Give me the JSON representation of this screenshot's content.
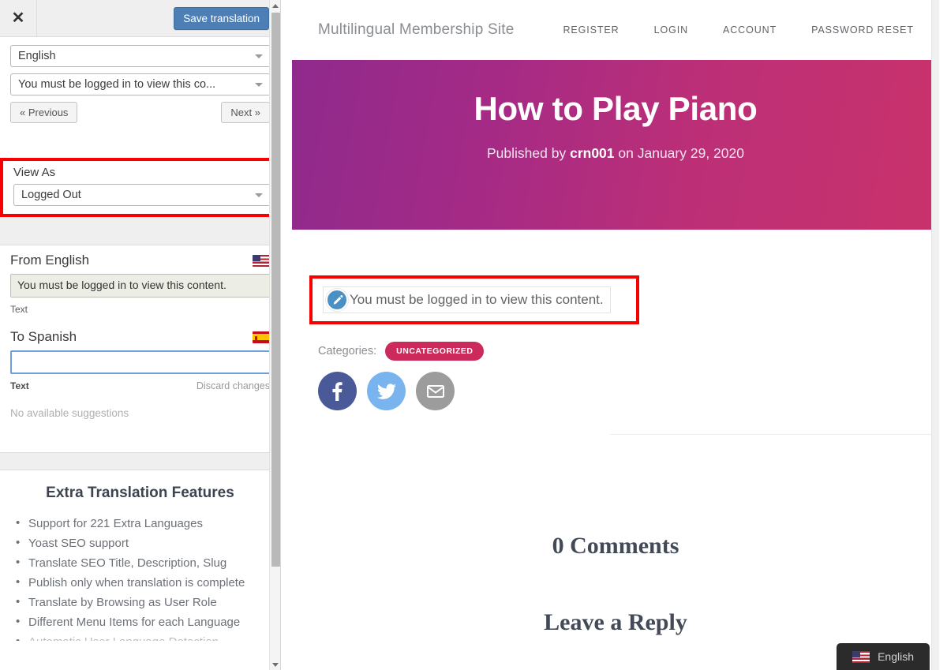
{
  "panel": {
    "close_label": "✕",
    "save_label": "Save translation",
    "language_select": "English",
    "string_select": "You must be logged in to view this co...",
    "previous_label": "« Previous",
    "next_label": "Next »",
    "view_as_label": "View As",
    "view_as_value": "Logged Out",
    "source": {
      "heading": "From English",
      "value": "You must be logged in to view this content.",
      "field_type": "Text",
      "flag": "us-flag-icon"
    },
    "target": {
      "heading": "To Spanish",
      "value": "",
      "placeholder": "",
      "field_type": "Text",
      "discard_label": "Discard changes",
      "suggestions": "No available suggestions",
      "flag": "es-flag-icon"
    },
    "features": {
      "title": "Extra Translation Features",
      "items": [
        "Support for 221 Extra Languages",
        "Yoast SEO support",
        "Translate SEO Title, Description, Slug",
        "Publish only when translation is complete",
        "Translate by Browsing as User Role",
        "Different Menu Items for each Language",
        "Automatic User Language Detection"
      ]
    }
  },
  "site": {
    "brand": "Multilingual Membership Site",
    "nav": [
      {
        "label": "Register"
      },
      {
        "label": "Login"
      },
      {
        "label": "Account"
      },
      {
        "label": "Password Reset"
      }
    ],
    "hero": {
      "title": "How to Play Piano",
      "published_prefix": "Published by",
      "author": "crn001",
      "published_suffix": "on January 29, 2020"
    },
    "content": {
      "text": "You must be logged in to view this content.",
      "edit_icon": "pencil-icon"
    },
    "categories": {
      "label": "Categories:",
      "badges": [
        "UNCATEGORIZED"
      ]
    },
    "share": [
      {
        "name": "facebook-share-button",
        "glyph": "f"
      },
      {
        "name": "twitter-share-button",
        "glyph": "🐦"
      },
      {
        "name": "email-share-button",
        "glyph": "✉"
      }
    ],
    "comments_heading": "0 Comments",
    "reply_heading": "Leave a Reply",
    "language_switcher": {
      "label": "English",
      "flag": "us-flag-icon"
    }
  },
  "colors": {
    "accent_purple": "#8f2a8c",
    "accent_pink": "#c9326b",
    "badge": "#cb2a5b",
    "highlight_red": "#f90000",
    "save_button": "#4c7fb5",
    "facebook": "#4a5a98",
    "twitter": "#79b4ee",
    "email": "#9c9c9c"
  }
}
